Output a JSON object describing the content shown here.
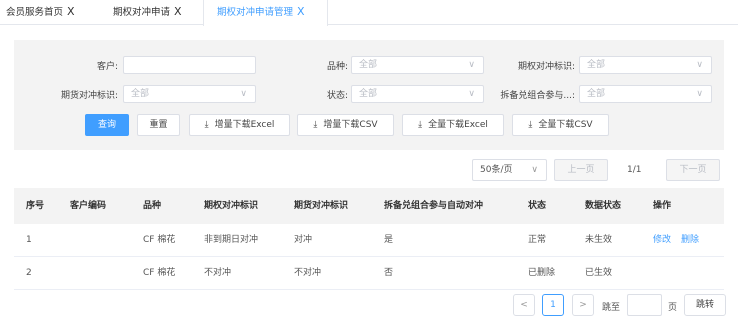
{
  "tabs": [
    {
      "label": "会员服务首页"
    },
    {
      "label": "期权对冲申请"
    },
    {
      "label": "期权对冲申请管理"
    }
  ],
  "tab_close_glyph": "X",
  "filters": {
    "customer_label": "客户:",
    "variety_label": "品种:",
    "variety_value": "全部",
    "option_hedge_label": "期权对冲标识:",
    "option_hedge_value": "全部",
    "futures_hedge_label": "期货对冲标识:",
    "futures_hedge_value": "全部",
    "status_label": "状态:",
    "status_value": "全部",
    "split_label": "拆备兑组合参与...:",
    "split_value": "全部"
  },
  "buttons": {
    "query": "查询",
    "reset": "重置",
    "incr_excel": "增量下载Excel",
    "incr_csv": "增量下载CSV",
    "full_excel": "全量下载Excel",
    "full_csv": "全量下载CSV"
  },
  "pager_top": {
    "page_size": "50条/页",
    "prev": "上一页",
    "page_info": "1/1",
    "next": "下一页"
  },
  "table": {
    "headers": [
      "序号",
      "客户编码",
      "品种",
      "期权对冲标识",
      "期货对冲标识",
      "拆备兑组合参与自动对冲",
      "状态",
      "数据状态",
      "操作"
    ],
    "rows": [
      {
        "no": "1",
        "code": "",
        "variety": "CF 棉花",
        "option_hedge": "非到期日对冲",
        "futures_hedge": "对冲",
        "split": "是",
        "status": "正常",
        "data_status": "未生效",
        "edit": "修改",
        "delete": "删除"
      },
      {
        "no": "2",
        "code": "",
        "variety": "CF 棉花",
        "option_hedge": "不对冲",
        "futures_hedge": "不对冲",
        "split": "否",
        "status": "已删除",
        "data_status": "已生效",
        "edit": "",
        "delete": ""
      }
    ]
  },
  "pager_bottom": {
    "prev_glyph": "<",
    "current_page": "1",
    "next_glyph": ">",
    "jump_to": "跳至",
    "page_unit": "页",
    "jump_button": "跳转"
  },
  "icons": {
    "caret": "chevron-down-icon",
    "download": "download-icon"
  },
  "colors": {
    "accent": "#409eff",
    "panel_bg": "#f3f3f3",
    "border": "#dcdfe6"
  }
}
